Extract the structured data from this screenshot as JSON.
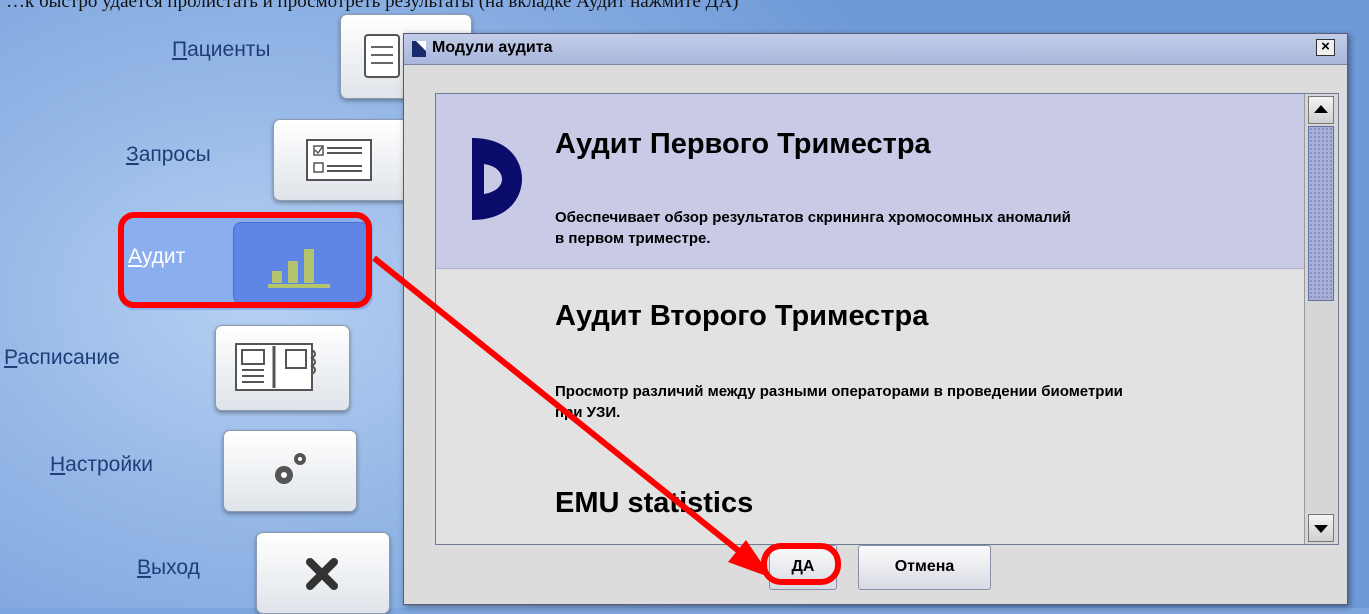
{
  "caption": "…к быстро удаётся пролистать и просмотреть результаты (на вкладке Аудит нажмите ДА)",
  "nav": {
    "patients": {
      "accel": "П",
      "rest": "ациенты"
    },
    "requests": {
      "accel": "З",
      "rest": "апросы"
    },
    "audit": {
      "accel": "А",
      "rest": "удит"
    },
    "schedule": {
      "accel": "Р",
      "rest": "асписание"
    },
    "settings": {
      "accel": "Н",
      "rest": "астройки"
    },
    "exit": {
      "accel": "В",
      "rest": "ыход"
    }
  },
  "dialog": {
    "title": "Модули аудита",
    "close_label": "×",
    "items": [
      {
        "title": "Аудит Первого Триместра",
        "desc_line1": "Обеспечивает обзор результатов скрининга хромосомных аномалий",
        "desc_line2": "в первом триместре.",
        "selected": true
      },
      {
        "title": "Аудит Второго Триместра",
        "desc_line1": "Просмотр различий между разными операторами в проведении биометрии",
        "desc_line2": "при УЗИ.",
        "selected": false
      },
      {
        "title": "EMU statistics",
        "desc_line1": "",
        "desc_line2": "",
        "selected": false
      }
    ],
    "ok_label": "ДА",
    "cancel_label": "Отмена"
  },
  "colors": {
    "annotation": "#ff0000",
    "selection": "#c9cbe6",
    "background": "#7ea6de"
  },
  "icons": [
    "patients-icon",
    "requests-icon",
    "bar-chart-icon",
    "schedule-icon",
    "gears-icon",
    "close-x-icon",
    "audit-module-logo-icon"
  ]
}
